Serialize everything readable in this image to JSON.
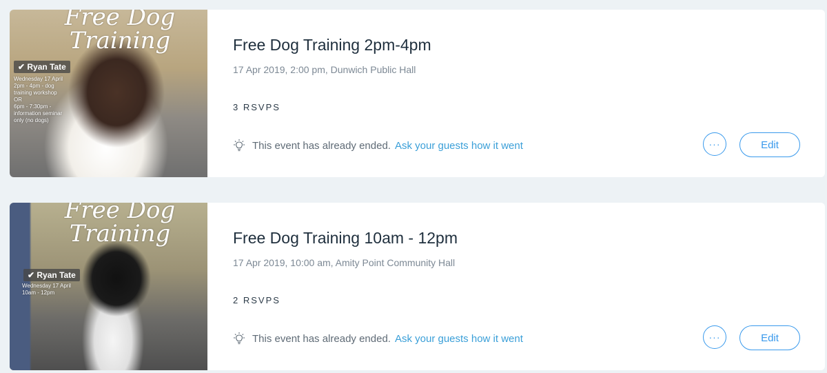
{
  "events": [
    {
      "title": "Free Dog Training 2pm-4pm",
      "meta": "17 Apr 2019, 2:00 pm, Dunwich Public Hall",
      "rsvps": "3 RSVPS",
      "status_text": "This event has already ended.",
      "feedback_link": "Ask your guests how it went",
      "more_label": "···",
      "edit_label": "Edit",
      "thumbnail": {
        "heading": "Free Dog\nTraining",
        "badge": "✔ Ryan Tate",
        "details": "Wednesday 17 April\n2pm - 4pm - dog training workshop\nOR\n6pm - 7:30pm - information seminar only (no dogs)"
      }
    },
    {
      "title": "Free Dog Training 10am - 12pm",
      "meta": "17 Apr 2019, 10:00 am, Amity Point Community Hall",
      "rsvps": "2 RSVPS",
      "status_text": "This event has already ended.",
      "feedback_link": "Ask your guests how it went",
      "more_label": "···",
      "edit_label": "Edit",
      "thumbnail": {
        "heading": "Free Dog\nTraining",
        "badge": "✔ Ryan Tate",
        "details": "Wednesday 17 April\n10am - 12pm"
      }
    }
  ],
  "colors": {
    "accent": "#3899ec",
    "link": "#3a9fd8",
    "title": "#1f2f3d",
    "muted": "#7c8894",
    "background": "#edf2f5"
  },
  "icons": {
    "status": "lightbulb-icon",
    "more": "more-dots-icon"
  }
}
